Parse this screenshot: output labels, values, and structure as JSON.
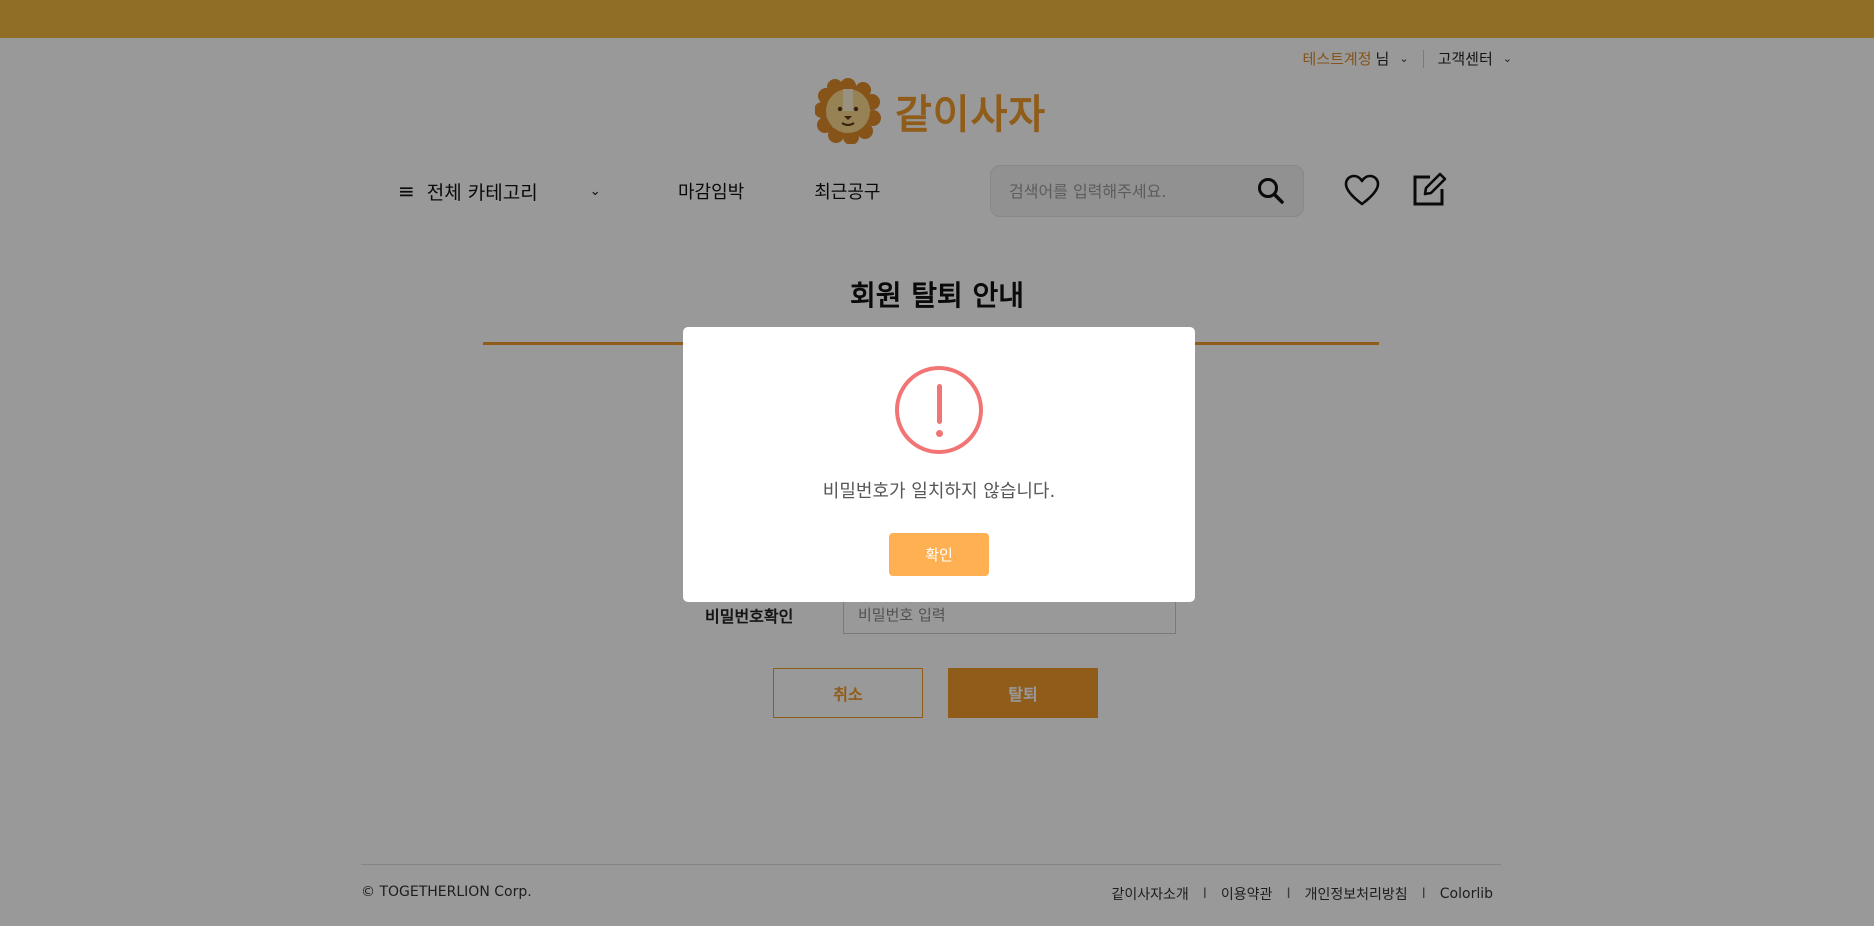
{
  "util": {
    "user_name": "테스트계정",
    "user_suffix": "님",
    "support": "고객센터"
  },
  "logo": {
    "text": "같이사자"
  },
  "nav": {
    "category": "전체 카테고리",
    "links": [
      "마감임박",
      "최근공구"
    ],
    "search_placeholder": "검색어를 입력해주세요."
  },
  "page": {
    "title": "회원 탈퇴 안내"
  },
  "form": {
    "confirm_label": "비밀번호확인",
    "confirm_placeholder": "비밀번호 입력",
    "cancel": "취소",
    "leave": "탈퇴"
  },
  "footer": {
    "copyright": "© TOGETHERLION Corp.",
    "links": [
      "같이사자소개",
      "이용약관",
      "개인정보처리방침",
      "Colorlib"
    ]
  },
  "modal": {
    "message": "비밀번호가 일치하지 않습니다.",
    "ok": "확인"
  },
  "colors": {
    "brand": "#f09a2c",
    "topbar": "#f2b740",
    "alert": "#f27474",
    "ok_button": "#ffb052"
  },
  "icons": [
    "hamburger-icon",
    "chevron-down-icon",
    "search-icon",
    "heart-icon",
    "edit-icon",
    "warning-icon",
    "lion-logo-icon"
  ]
}
